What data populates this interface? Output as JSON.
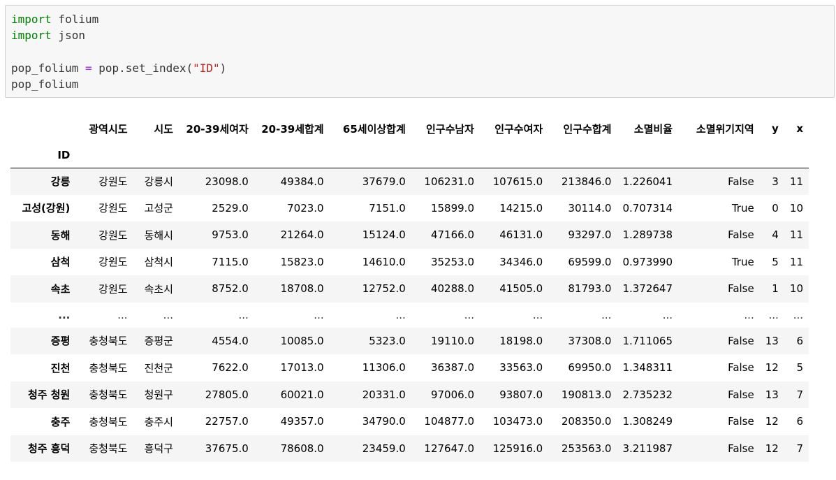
{
  "code": {
    "line1": {
      "kw": "import",
      "rest": " folium"
    },
    "line2": {
      "kw": "import",
      "rest": " json"
    },
    "line3": {
      "lhs": "pop_folium ",
      "op": "=",
      "mid": " pop.set_index(",
      "str": "\"ID\"",
      "end": ")"
    },
    "line4": {
      "text": "pop_folium"
    }
  },
  "table": {
    "index_name": "ID",
    "columns": [
      "광역시도",
      "시도",
      "20-39세여자",
      "20-39세합계",
      "65세이상합계",
      "인구수남자",
      "인구수여자",
      "인구수합계",
      "소멸비율",
      "소멸위기지역",
      "y",
      "x"
    ],
    "rows": [
      {
        "id": "강릉",
        "cells": [
          "강원도",
          "강릉시",
          "23098.0",
          "49384.0",
          "37679.0",
          "106231.0",
          "107615.0",
          "213846.0",
          "1.226041",
          "False",
          "3",
          "11"
        ]
      },
      {
        "id": "고성(강원)",
        "cells": [
          "강원도",
          "고성군",
          "2529.0",
          "7023.0",
          "7151.0",
          "15899.0",
          "14215.0",
          "30114.0",
          "0.707314",
          "True",
          "0",
          "10"
        ]
      },
      {
        "id": "동해",
        "cells": [
          "강원도",
          "동해시",
          "9753.0",
          "21264.0",
          "15124.0",
          "47166.0",
          "46131.0",
          "93297.0",
          "1.289738",
          "False",
          "4",
          "11"
        ]
      },
      {
        "id": "삼척",
        "cells": [
          "강원도",
          "삼척시",
          "7115.0",
          "15823.0",
          "14610.0",
          "35253.0",
          "34346.0",
          "69599.0",
          "0.973990",
          "True",
          "5",
          "11"
        ]
      },
      {
        "id": "속초",
        "cells": [
          "강원도",
          "속초시",
          "8752.0",
          "18708.0",
          "12752.0",
          "40288.0",
          "41505.0",
          "81793.0",
          "1.372647",
          "False",
          "1",
          "10"
        ]
      },
      {
        "id": "...",
        "cells": [
          "...",
          "...",
          "...",
          "...",
          "...",
          "...",
          "...",
          "...",
          "...",
          "...",
          "...",
          "..."
        ]
      },
      {
        "id": "증평",
        "cells": [
          "충청북도",
          "증평군",
          "4554.0",
          "10085.0",
          "5323.0",
          "19110.0",
          "18198.0",
          "37308.0",
          "1.711065",
          "False",
          "13",
          "6"
        ]
      },
      {
        "id": "진천",
        "cells": [
          "충청북도",
          "진천군",
          "7622.0",
          "17013.0",
          "11306.0",
          "36387.0",
          "33563.0",
          "69950.0",
          "1.348311",
          "False",
          "12",
          "5"
        ]
      },
      {
        "id": "청주 청원",
        "cells": [
          "충청북도",
          "청원구",
          "27805.0",
          "60021.0",
          "20331.0",
          "97006.0",
          "93807.0",
          "190813.0",
          "2.735232",
          "False",
          "13",
          "7"
        ]
      },
      {
        "id": "충주",
        "cells": [
          "충청북도",
          "충주시",
          "22757.0",
          "49357.0",
          "34790.0",
          "104877.0",
          "103473.0",
          "208350.0",
          "1.308249",
          "False",
          "12",
          "6"
        ]
      },
      {
        "id": "청주 흥덕",
        "cells": [
          "충청북도",
          "흥덕구",
          "37675.0",
          "78608.0",
          "23459.0",
          "127647.0",
          "125916.0",
          "253563.0",
          "3.211987",
          "False",
          "12",
          "7"
        ]
      }
    ]
  },
  "colors": {
    "keyword": "#008000",
    "operator": "#aa22ff",
    "string": "#ba2121",
    "code_bg": "#f7f7f7",
    "row_stripe": "#f5f5f5"
  }
}
